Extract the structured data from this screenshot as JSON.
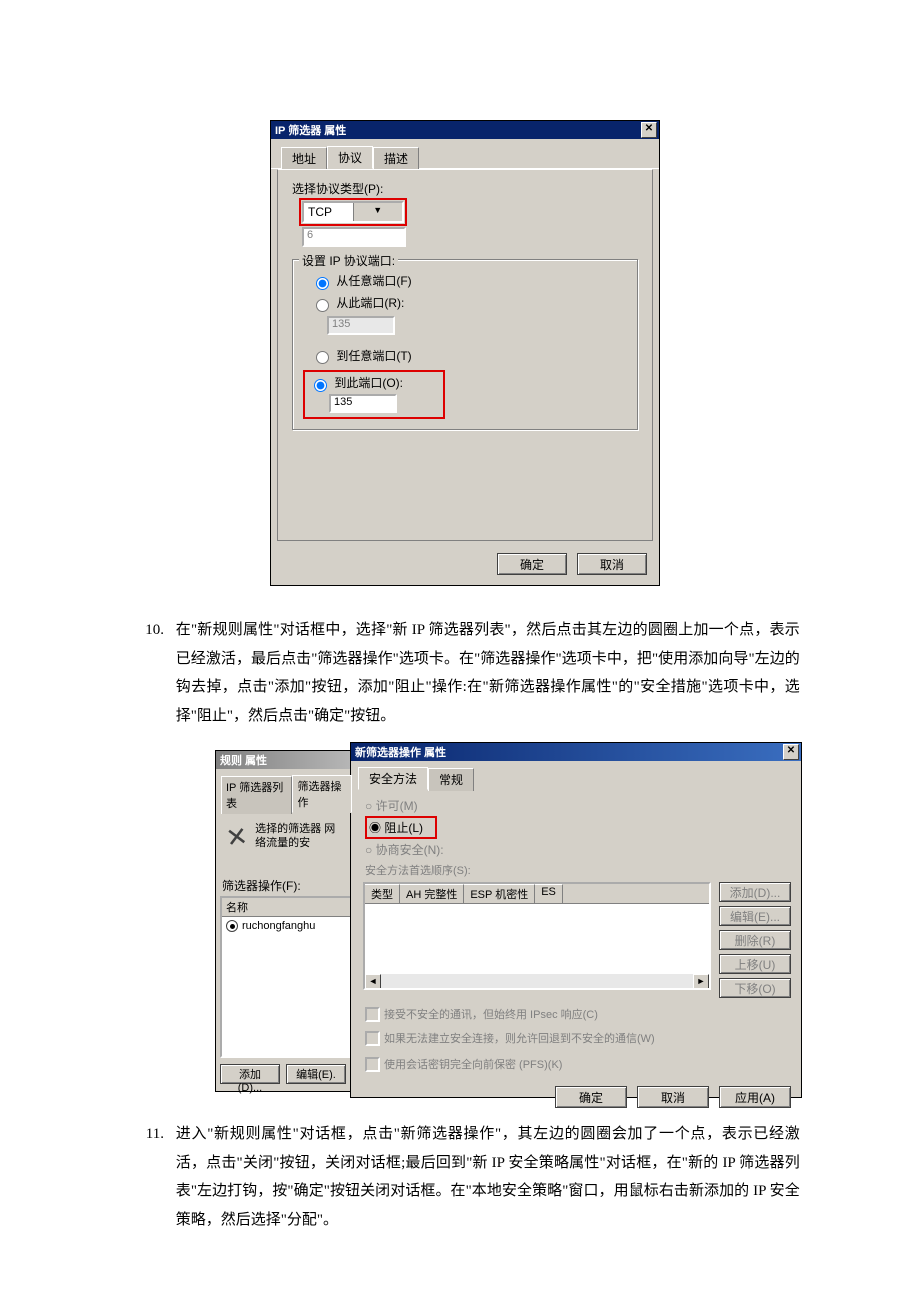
{
  "dialog1": {
    "title": "IP 筛选器 属性",
    "close": "✕",
    "tabs": {
      "address": "地址",
      "protocol": "协议",
      "desc": "描述"
    },
    "protoType": {
      "label": "选择协议类型(P):",
      "value": "TCP",
      "numval": "6"
    },
    "ports": {
      "groupTitle": "设置 IP 协议端口:",
      "fromAny": "从任意端口(F)",
      "fromThis": "从此端口(R):",
      "fromThisVal": "135",
      "toAny": "到任意端口(T)",
      "toThis": "到此端口(O):",
      "toThisVal": "135"
    },
    "ok": "确定",
    "cancel": "取消"
  },
  "para10": {
    "num": "10.",
    "text": "在\"新规则属性\"对话框中，选择\"新 IP 筛选器列表\"，然后点击其左边的圆圈上加一个点，表示已经激活，最后点击\"筛选器操作\"选项卡。在\"筛选器操作\"选项卡中，把\"使用添加向导\"左边的钩去掉，点击\"添加\"按钮，添加\"阻止\"操作:在\"新筛选器操作属性\"的\"安全措施\"选项卡中，选择\"阻止\"，然后点击\"确定\"按钮。"
  },
  "left": {
    "title": "规则 属性",
    "tabFilterList": "IP 筛选器列表",
    "tabFilterAction": "筛选器操作",
    "helper": "选择的筛选器\n网络流量的安",
    "listLabel": "筛选器操作(F):",
    "colName": "名称",
    "item": "ruchongfanghu",
    "add": "添加(D)...",
    "edit": "编辑(E)."
  },
  "right": {
    "title": "新筛选器操作 属性",
    "close": "✕",
    "tabSec": "安全方法",
    "tabGen": "常规",
    "optPermit": "许可(M)",
    "optBlock": "阻止(L)",
    "optNeg": "协商安全(N):",
    "prefOrder": "安全方法首选顺序(S):",
    "cols": {
      "type": "类型",
      "ah": "AH 完整性",
      "esp": "ESP 机密性",
      "es": "ES"
    },
    "btns": {
      "add": "添加(D)...",
      "edit": "编辑(E)...",
      "del": "删除(R)",
      "up": "上移(U)",
      "down": "下移(O)"
    },
    "chk1": "接受不安全的通讯，但始终用 IPsec 响应(C)",
    "chk2": "如果无法建立安全连接，则允许回退到不安全的通信(W)",
    "chk3": "使用会话密钥完全向前保密 (PFS)(K)",
    "ok": "确定",
    "cancel": "取消",
    "apply": "应用(A)"
  },
  "para11": {
    "num": "11.",
    "text": "进入\"新规则属性\"对话框，点击\"新筛选器操作\"，其左边的圆圈会加了一个点，表示已经激活，点击\"关闭\"按钮，关闭对话框;最后回到\"新 IP 安全策略属性\"对话框，在\"新的 IP 筛选器列表\"左边打钩，按\"确定\"按钮关闭对话框。在\"本地安全策略\"窗口，用鼠标右击新添加的 IP 安全策略，然后选择\"分配\"。"
  }
}
